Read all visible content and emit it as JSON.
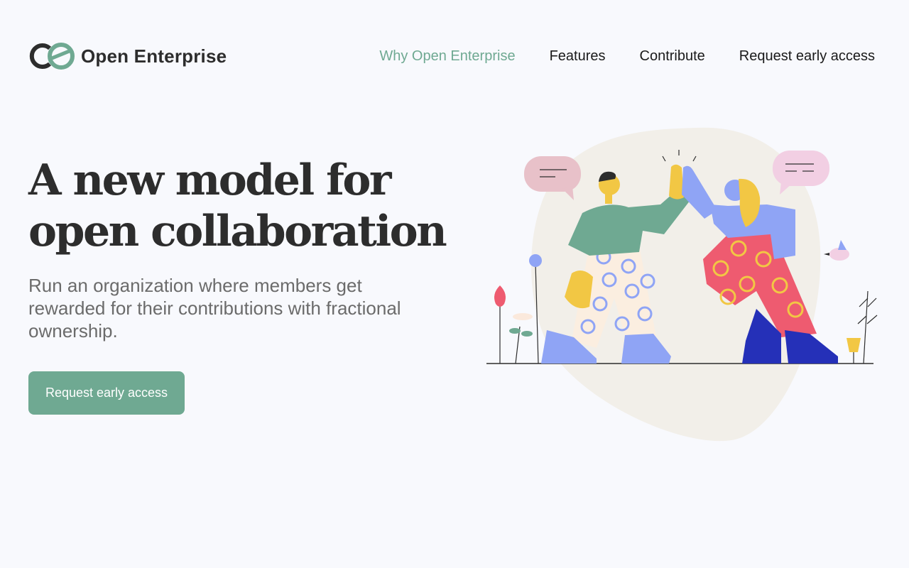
{
  "brand": {
    "name": "Open Enterprise",
    "logo_icon": "open-enterprise-logo"
  },
  "nav": {
    "items": [
      {
        "label": "Why Open Enterprise",
        "active": true
      },
      {
        "label": "Features",
        "active": false
      },
      {
        "label": "Contribute",
        "active": false
      },
      {
        "label": "Request early access",
        "active": false
      }
    ]
  },
  "hero": {
    "title_line1": "A new model for",
    "title_line2": "open collaboration",
    "subtitle": "Run an organization where members get rewarded for their contributions with fractional ownership.",
    "cta_label": "Request early access"
  },
  "colors": {
    "accent": "#6fa992",
    "background": "#f8f9fd",
    "text": "#2d2d2d"
  }
}
